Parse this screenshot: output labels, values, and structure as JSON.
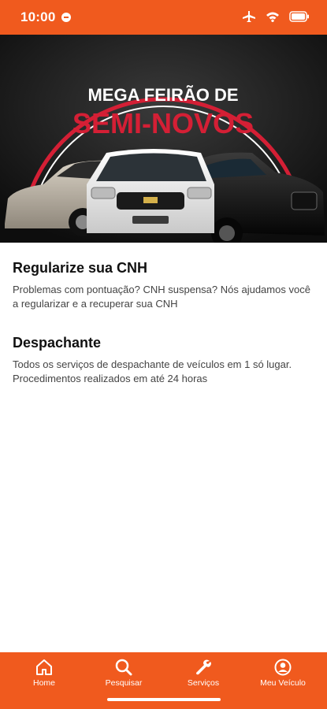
{
  "status": {
    "time": "10:00"
  },
  "banner": {
    "line1": "MEGA FEIRÃO DE",
    "line2": "SEMI-NOVOS"
  },
  "services": [
    {
      "title": "Regularize sua CNH",
      "description": "Problemas com pontuação? CNH suspensa? Nós ajudamos você a regularizar e a recuperar sua CNH"
    },
    {
      "title": "Despachante",
      "description": "Todos os serviços de despachante de veículos em 1 só lugar. Procedimentos realizados em até 24 horas"
    }
  ],
  "nav": {
    "items": [
      {
        "label": "Home",
        "icon": "home-icon"
      },
      {
        "label": "Pesquisar",
        "icon": "search-icon"
      },
      {
        "label": "Serviços",
        "icon": "wrench-icon"
      },
      {
        "label": "Meu Veículo",
        "icon": "user-icon"
      }
    ]
  },
  "colors": {
    "accent": "#f05a1e",
    "banner_red": "#d41f35"
  }
}
